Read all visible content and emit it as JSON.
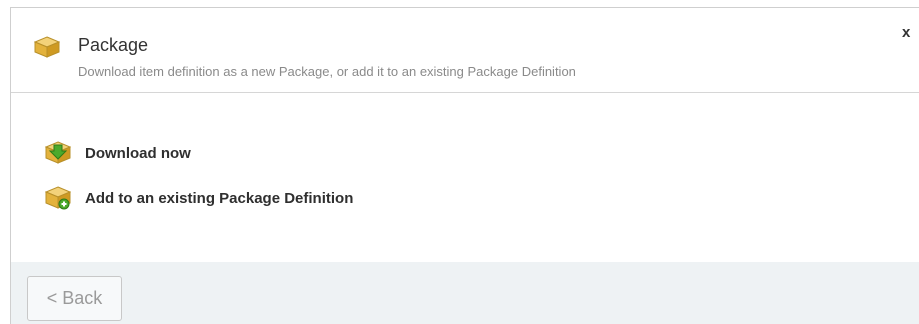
{
  "dialog": {
    "title": "Package",
    "subtitle": "Download item definition as a new Package, or add it to an existing Package Definition",
    "close_label": "x",
    "header_icon": "package-box-icon"
  },
  "options": [
    {
      "label": "Download now",
      "icon": "download-package-icon"
    },
    {
      "label": "Add to an existing Package Definition",
      "icon": "add-package-icon"
    }
  ],
  "footer": {
    "back_label": "< Back"
  },
  "colors": {
    "footer_bg": "#eef2f4",
    "box_gold": "#e8b83a",
    "arrow_green": "#4caa2c"
  }
}
